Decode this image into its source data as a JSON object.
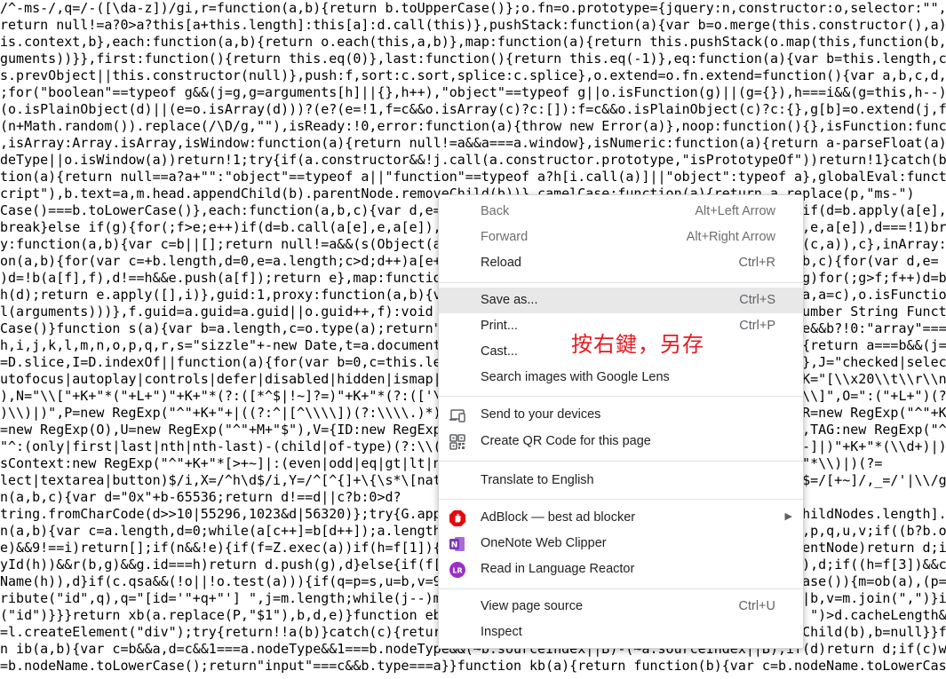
{
  "code_lines": [
    "/^-ms-/,q=/-([\\da-z])/gi,r=function(a,b){return b.toUpperCase()};o.fn=o.prototype={jquery:n,constructor:o,selector:\"\",le",
    "return null!=a?0>a?this[a+this.length]:this[a]:d.call(this)},pushStack:function(a){var b=o.merge(this.constructor(),a);r",
    "is.context,b},each:function(a,b){return o.each(this,a,b)},map:function(a){return this.pushStack(o.map(this,function(b,c)",
    "guments))}},first:function(){return this.eq(0)},last:function(){return this.eq(-1)},eq:function(a){var b=this.length,c=+a",
    "s.prevObject||this.constructor(null)},push:f,sort:c.sort,splice:c.splice},o.extend=o.fn.extend=function(){var a,b,c,d,e,",
    ";for(\"boolean\"==typeof g&&(j=g,g=arguments[h]||{},h++),\"object\"==typeof g||o.isFunction(g)||(g={}),h===i&&(g=this,h--);i",
    "(o.isPlainObject(d)||(e=o.isArray(d)))?(e?(e=!1,f=c&&o.isArray(c)?c:[]):f=c&&o.isPlainObject(c)?c:{},g[b]=o.extend(j,f,d",
    "(n+Math.random()).replace(/\\D/g,\"\"),isReady:!0,error:function(a){throw new Error(a)},noop:function(){},isFunction:functi",
    ",isArray:Array.isArray,isWindow:function(a){return null!=a&&a===a.window},isNumeric:function(a){return a-parseFloat(a)>=",
    "deType||o.isWindow(a))return!1;try{if(a.constructor&&!j.call(a.constructor.prototype,\"isPrototypeOf\"))return!1}catch(b){",
    "tion(a){return null==a?a+\"\":\"object\"==typeof a||\"function\"==typeof a?h[i.call(a)]||\"object\":typeof a},globalEval:functio",
    "cript\"),b.text=a,m.head.appendChild(b).parentNode.removeChild(b))},camelCase:function(a){return a.replace(p,\"ms-\")",
    "Case()===b.toLowerCase()},each:function(a,b,c){var d,e=0,f=a.length,g=s(a);if(c){if(g){for(;f>e;e++)if(d=b.apply(a[e],c)",
    "break}else if(g){for(;f>e;e++)if(d=b.call(a[e],e,a[e]),d===!1)break}else for(e in a)if(d=b.call(a[e],e,a[e]),d===!1)brea",
    "y:function(a,b){var c=b||[];return null!=a&&(s(Object(a))?o.merge(c,\"string\"==typeof a?[a]:a):g.call(c,a)),c},inArray:fu",
    "on(a,b){for(var c=+b.length,d=0,e=a.length;c>d;d++)a[e++]=b[d];return a.length=e,a},grep:function(a,b,c){for(var d,e=",
    ")d=!b(a[f],f),d!==h&&e.push(a[f]);return e},map:function(a,b,c){var d,e=0,f=a.length,g=s(a),h=[];if(g)for(;g>f;f++)d=b(a",
    "h(d);return e.apply([],i)},guid:1,proxy:function(a,b){var c,d,f;return\"string\"==typeof b&&(c=a[b],b=a,a=c),o.isFunction(",
    "l(arguments)))},f.guid=a.guid=a.guid||o.guid++,f):void 0},now:Date.now,support:l}),o.each(\"Boolean Number String Functio",
    "Case()}function s(a){var b=a.length,c=o.type(a);return\"function\"===c||o.isWindow(a)?!1:1===a.nodeType&&b?!0:\"array\"===",
    "h,i,j,k,l,m,n,o,p,q,r,s=\"sizzle\"+-new Date,t=a.document,u=0,v=0,w=eb(),x=eb(),y=eb(),z=function(a,b){return a===b&&(j=!0",
    "=D.slice,I=D.indexOf||function(a){for(var b=0,c=this.length;c>b;b++)if(this[b]===a)return b;return-1},J=\"checked|selecte",
    "utofocus|autoplay|controls|defer|disabled|hidden|ismap|loop|multiple|open|readonly|required|scoped\",K=\"[\\\\x20\\\\t\\\\r\\\\n\\\\f",
    "),N=\"\\\\[\"+K+\"*(\"+L+\")\"+K+\"*(?:([*^$|!~]?=)\"+K+\"*(?:(['\\\"])((?:\\\\\\\\.|[^\\\\\\\\])*?)\\\\3|(\"+M+\")|)|)\"+K+\"*\\\\]\",O=\":(\"+L+\")(?:\\\\",
    ")\\\\)|)\",P=new RegExp(\"^\"+K+\"+|((?:^|[^\\\\\\\\])(?:\\\\\\\\.)*)\"+K+\"+$\",\"g\"),Q=new RegExp(\"^\"+K+\"*,\"+K+\"*\"),R=new RegExp(\"^\"+K+\"",
    "=new RegExp(O),U=new RegExp(\"^\"+M+\"$\"),V={ID:new RegExp(\"^#(\"+L+\")\"),CLASS:new RegExp(\"^\\\\.(\"+L+\")\"),TAG:new RegExp(\"^(\"",
    "\"^:(only|first|last|nth|nth-last)-(child|of-type)(?:\\\\(\"+K+\"*(even|odd|(([+-]|)(\\\\d*)n|)\"+K+\"*(?:([+-]|)\"+K+\"*(\\\\d+)|))",
    "sContext:new RegExp(\"^\"+K+\"*[>+~]|:(even|odd|eq|gt|lt|nth|first|last)(?:\\\\(\"+K+\"*((?:-\\\\d)?\\\\d*)\"+K+\"*\\\\)|)(?=",
    "lect|textarea|button)$/i,X=/^h\\d$/i,Y=/^[^{]+\\{\\s*\\[native \\w/,Z=/^(?:#([\\w-]+)|(\\w+)|\\.([\\w-]+))$/,$=/[+~]/,_=/'|\\\\/g,a",
    "n(a,b,c){var d=\"0x\"+b-65536;return d!==d||c?b:0>d?",
    "tring.fromCharCode(d>>10|55296,1023&d|56320)};try{G.apply(D=H.call(t.childNodes),t.childNodes),D[t.childNodes.length].no",
    "n(a,b){var c=a.length,d=0;while(a[c++]=b[d++]);a.length=c-1}}}function db(a,b,d,e){var f,g,h,i,j,k,l,p,q,u,v;if((b?b.owner",
    "e)&&9!==i)return[];if(n&&!e){if(f=Z.exec(a))if(h=f[1]){if(9===i){if(g=b.getElementById(h),!g||!g.parentNode)return d;if(",
    "yId(h))&&r(b,g)&&g.id===h)return d.push(g),d}else{if(f[2])return G.apply(d,b.getElementsByTagName(a)),d;if((h=f[3])&&c.g",
    "Name(h)),d}if(c.qsa&&(!o||!o.test(a))){if(q=p=s,u=b,v=9===i&&a,1===i&&\"object\"!==b.nodeName.toLowerCase()){m=ob(a),(p=b.",
    "ribute(\"id\",q),q=\"[id='\"+q+\"'] \",j=m.length;while(j--)m[j]=q+pb(m[j]);u=$.test(a)&&mb(b.parentNode)||b,v=m.join(\",\")}if(",
    "(\"id\")}}}return xb(a.replace(P,\"$1\"),b,d,e)}function eb(){var a=[];function b(c,e){return a.push(c+\" \")>d.cacheLength&&d",
    "=l.createElement(\"div\");try{return!!a(b)}catch(c){return!1}finally{b.parentNode&&b.parentNode.removeChild(b),b=null}}fun",
    "n ib(a,b){var c=b&&a,d=c&&1===a.nodeType&&1===b.nodeType&&(~b.sourceIndex||B)-(~a.sourceIndex||B);if(d)return d;if(c)whi",
    "=b.nodeName.toLowerCase();return\"input\"===c&&b.type===a}}function kb(a){return function(b){var c=b.nodeName.toLowerCase("
  ],
  "menu": {
    "back": {
      "label": "Back",
      "shortcut": "Alt+Left Arrow"
    },
    "forward": {
      "label": "Forward",
      "shortcut": "Alt+Right Arrow"
    },
    "reload": {
      "label": "Reload",
      "shortcut": "Ctrl+R"
    },
    "save_as": {
      "label": "Save as...",
      "shortcut": "Ctrl+S"
    },
    "print": {
      "label": "Print...",
      "shortcut": "Ctrl+P"
    },
    "cast": {
      "label": "Cast..."
    },
    "search_lens": {
      "label": "Search images with Google Lens"
    },
    "send_devices": {
      "label": "Send to your devices",
      "icon": "devices-icon"
    },
    "qr_code": {
      "label": "Create QR Code for this page",
      "icon": "qr-code-icon"
    },
    "translate": {
      "label": "Translate to English"
    },
    "adblock": {
      "label": "AdBlock — best ad blocker",
      "icon": "adblock-icon",
      "icon_color": "#e8050b"
    },
    "onenote": {
      "label": "OneNote Web Clipper",
      "icon": "onenote-icon",
      "icon_color": "#7b3ab0"
    },
    "language_reactor": {
      "label": "Read in Language Reactor",
      "icon": "language-reactor-icon",
      "icon_color": "#9c2fc5"
    },
    "view_source": {
      "label": "View page source",
      "shortcut": "Ctrl+U"
    },
    "inspect": {
      "label": "Inspect"
    }
  },
  "annotation": {
    "text": "按右鍵，另存",
    "color": "#e31c23"
  }
}
